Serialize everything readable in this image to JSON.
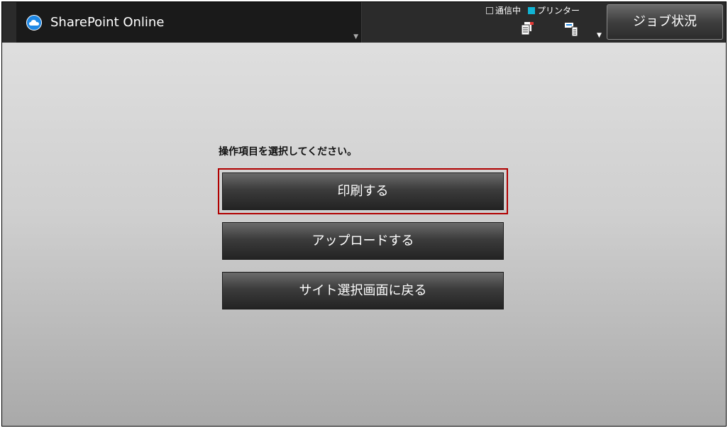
{
  "header": {
    "app_title": "SharePoint Online",
    "app_icon": "cloud-icon",
    "status": {
      "communicating_label": "通信中",
      "printer_label": "プリンター"
    },
    "job_status_label": "ジョブ状況"
  },
  "main": {
    "prompt": "操作項目を選択してください。",
    "buttons": [
      {
        "label": "印刷する",
        "focused": true
      },
      {
        "label": "アップロードする",
        "focused": false
      },
      {
        "label": "サイト選択画面に戻る",
        "focused": false
      }
    ]
  },
  "colors": {
    "focus": "#b00000",
    "printer_indicator": "#11b4d4",
    "cloud": "#1e88e5"
  }
}
